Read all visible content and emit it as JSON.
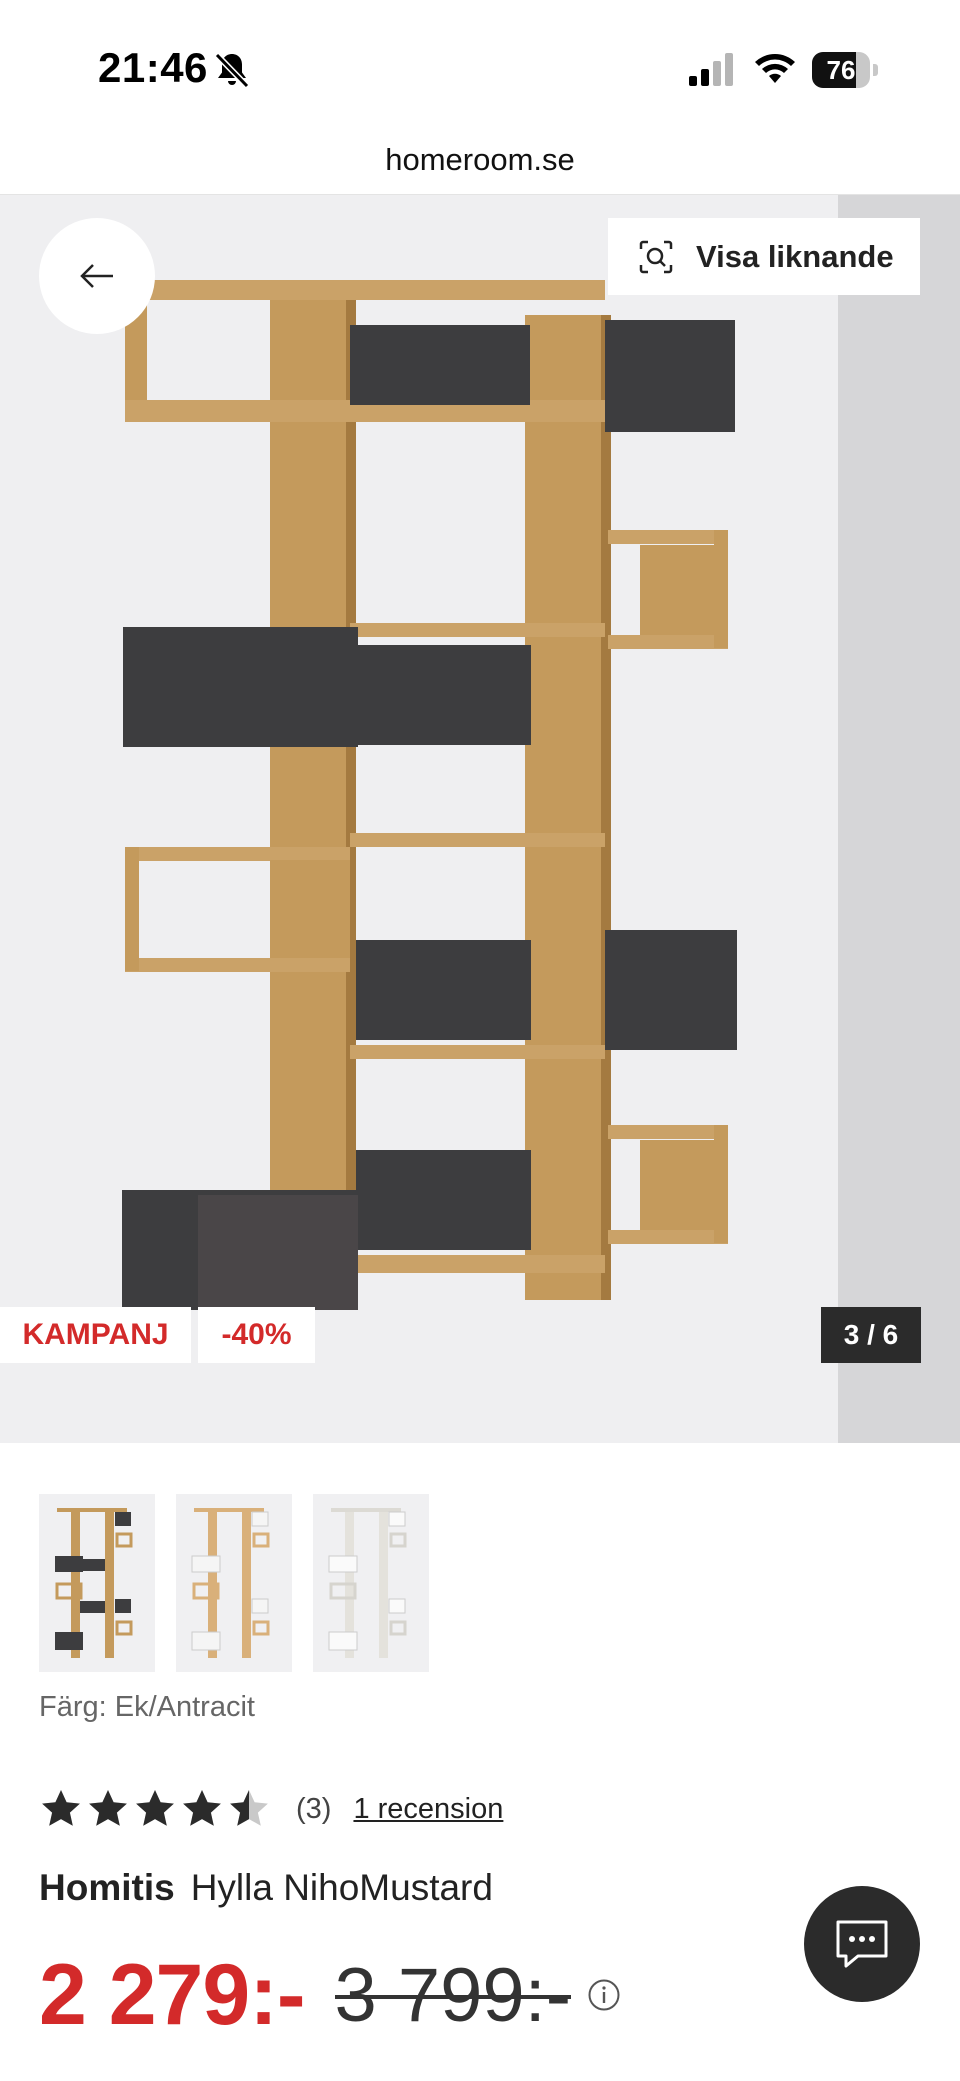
{
  "status_bar": {
    "time": "21:46",
    "battery_level": "76",
    "battery_fraction": 0.76
  },
  "browser": {
    "url": "homeroom.se"
  },
  "gallery": {
    "similar_label": "Visa liknande",
    "badge_campaign": "KAMPANJ",
    "badge_discount": "-40%",
    "counter": "3 / 6"
  },
  "product": {
    "color_label": "Färg: Ek/Antracit",
    "rating_value": 4.5,
    "rating_count": "(3)",
    "reviews_link": "1 recension",
    "brand": "Homitis",
    "name": "Hylla NihoMustard",
    "price_current": "2 279:-",
    "price_old": "3 799:-"
  },
  "colors": {
    "accent_red": "#d32a2a",
    "oak": "#c49a5c",
    "anthracite": "#3d3d3f"
  },
  "icons": [
    "bell-slash-icon",
    "signal-icon",
    "wifi-icon",
    "battery-icon",
    "arrow-left-icon",
    "visual-search-icon",
    "star-icon",
    "info-icon",
    "chat-icon"
  ]
}
